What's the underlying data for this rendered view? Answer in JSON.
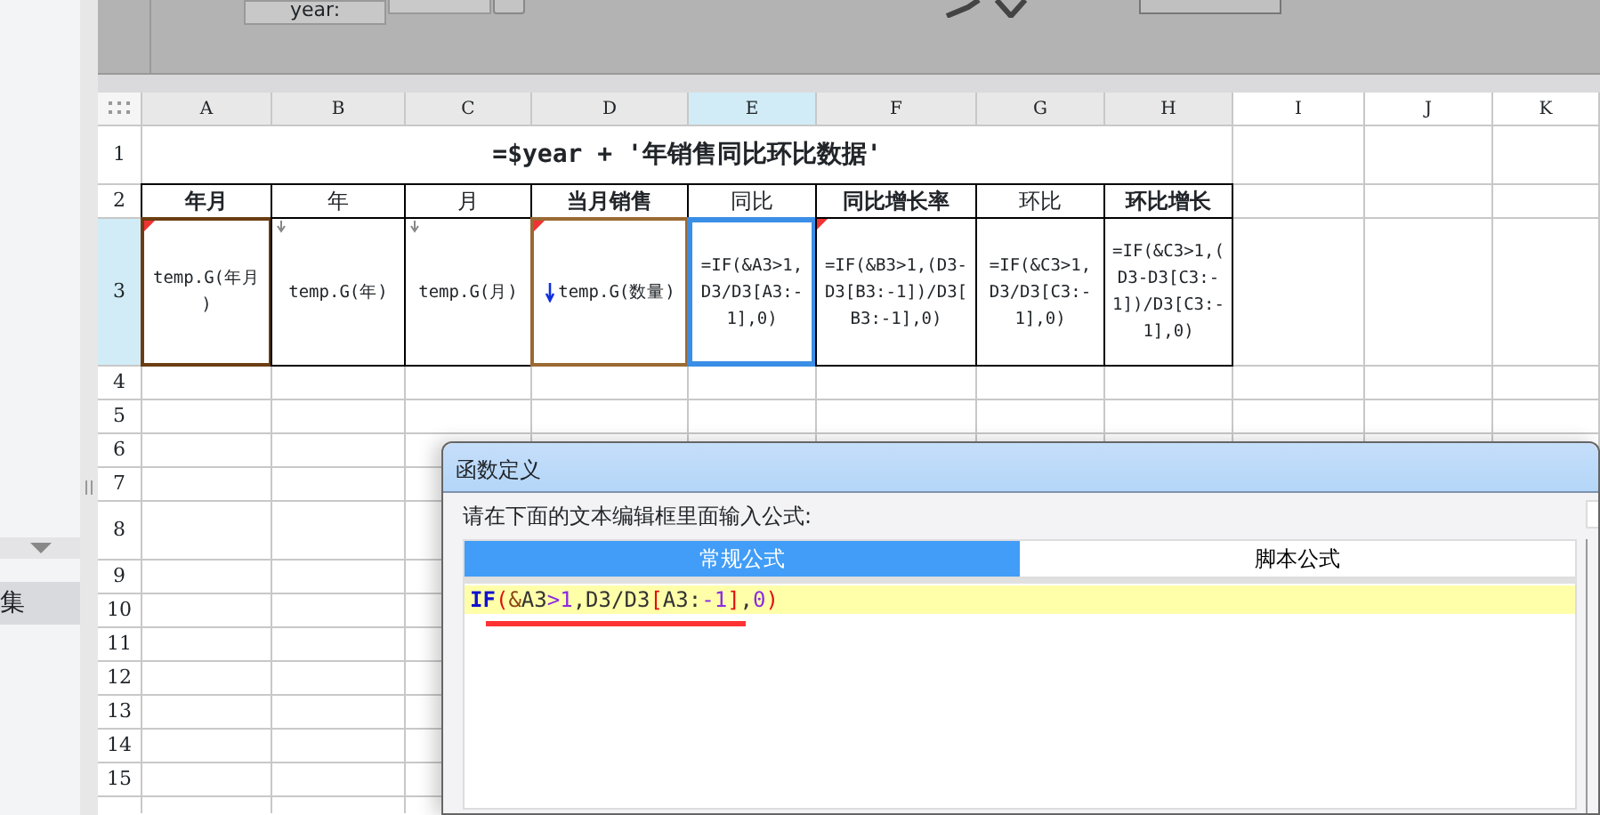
{
  "toolbar": {
    "year_label": "year:"
  },
  "sidebar": {
    "items": [
      {
        "label": "集",
        "selected": true
      }
    ]
  },
  "sheet": {
    "columns": [
      {
        "label": "A",
        "selected": false
      },
      {
        "label": "B",
        "selected": false
      },
      {
        "label": "C",
        "selected": false
      },
      {
        "label": "D",
        "selected": false
      },
      {
        "label": "E",
        "selected": true
      },
      {
        "label": "F",
        "selected": false
      },
      {
        "label": "G",
        "selected": false
      },
      {
        "label": "H",
        "selected": false
      },
      {
        "label": "I",
        "selected": false
      },
      {
        "label": "J",
        "selected": false
      },
      {
        "label": "K",
        "selected": false
      }
    ],
    "rows": [
      {
        "label": "1",
        "selected": false
      },
      {
        "label": "2",
        "selected": false
      },
      {
        "label": "3",
        "selected": true
      },
      {
        "label": "4",
        "selected": false
      },
      {
        "label": "5",
        "selected": false
      },
      {
        "label": "6",
        "selected": false
      },
      {
        "label": "7",
        "selected": false
      },
      {
        "label": "8",
        "selected": false
      },
      {
        "label": "9",
        "selected": false
      },
      {
        "label": "10",
        "selected": false
      },
      {
        "label": "11",
        "selected": false
      },
      {
        "label": "12",
        "selected": false
      },
      {
        "label": "13",
        "selected": false
      },
      {
        "label": "14",
        "selected": false
      },
      {
        "label": "15",
        "selected": false
      }
    ],
    "title_cell": {
      "text": "=$year + '年销售同比环比数据'"
    },
    "header_cells": [
      {
        "text": "年月",
        "bold": true
      },
      {
        "text": "年",
        "bold": false
      },
      {
        "text": "月",
        "bold": false
      },
      {
        "text": "当月销售",
        "bold": true
      },
      {
        "text": "同比",
        "bold": false
      },
      {
        "text": "同比增长率",
        "bold": true
      },
      {
        "text": "环比",
        "bold": false
      },
      {
        "text": "环比增长",
        "bold": true
      }
    ],
    "data_cells": [
      {
        "lines": [
          "temp.G(年月",
          ")"
        ],
        "kind": "group",
        "selected": false
      },
      {
        "lines": [
          "temp.G(年)"
        ],
        "kind": "list",
        "selected": false
      },
      {
        "lines": [
          "temp.G(月)"
        ],
        "kind": "list",
        "selected": false
      },
      {
        "lines": [
          "temp.G(数量)"
        ],
        "kind": "sum",
        "selected": false
      },
      {
        "lines": [
          "=IF(&A3>1,",
          "D3/D3[A3:-",
          "1],0)"
        ],
        "kind": "formula",
        "selected": true
      },
      {
        "lines": [
          "=IF(&B3>1,(D3-",
          "D3[B3:-1])/D3[",
          "B3:-1],0)"
        ],
        "kind": "flagged",
        "selected": false
      },
      {
        "lines": [
          "=IF(&C3>1,",
          "D3/D3[C3:-",
          "1],0)"
        ],
        "kind": "formula",
        "selected": false
      },
      {
        "lines": [
          "=IF(&C3>1,(",
          "D3-D3[C3:-",
          "1])/D3[C3:-",
          "1],0)"
        ],
        "kind": "formula",
        "selected": false
      }
    ]
  },
  "dialog": {
    "title": "函数定义",
    "prompt": "请在下面的文本编辑框里面输入公式:",
    "tabs": [
      {
        "label": "常规公式",
        "selected": true
      },
      {
        "label": "脚本公式",
        "selected": false
      }
    ],
    "formula": [
      {
        "text": "IF",
        "kind": "keyword"
      },
      {
        "text": "(",
        "kind": "paren"
      },
      {
        "text": "&",
        "kind": "operator"
      },
      {
        "text": "A3",
        "kind": "plain"
      },
      {
        "text": ">1",
        "kind": "number"
      },
      {
        "text": ",D3/D3",
        "kind": "plain"
      },
      {
        "text": "[",
        "kind": "paren"
      },
      {
        "text": "A3:",
        "kind": "plain"
      },
      {
        "text": "-1",
        "kind": "number"
      },
      {
        "text": "]",
        "kind": "paren"
      },
      {
        "text": ",",
        "kind": "plain"
      },
      {
        "text": "0",
        "kind": "number"
      },
      {
        "text": ")",
        "kind": "paren"
      }
    ],
    "underlined": true
  }
}
